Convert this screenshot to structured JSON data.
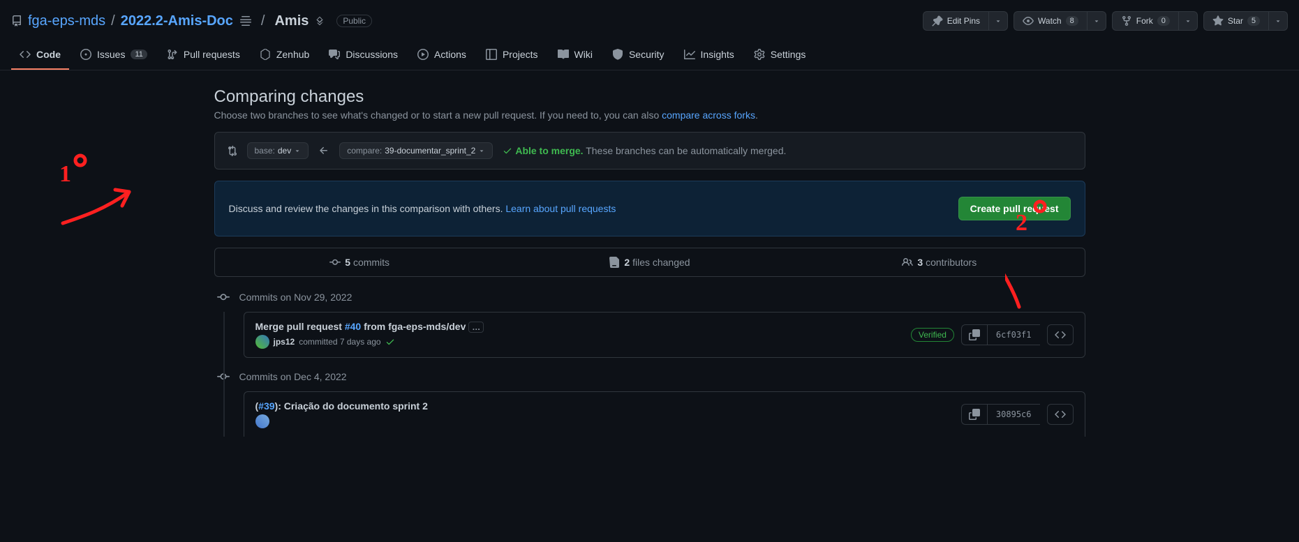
{
  "repo": {
    "owner": "fga-eps-mds",
    "name": "2022.2-Amis-Doc",
    "context": "Amis",
    "visibility": "Public"
  },
  "header_buttons": {
    "edit_pins": "Edit Pins",
    "watch": "Watch",
    "watch_count": "8",
    "fork": "Fork",
    "fork_count": "0",
    "star": "Star",
    "star_count": "5"
  },
  "tabs": {
    "code": "Code",
    "issues": "Issues",
    "issues_count": "11",
    "pulls": "Pull requests",
    "zenhub": "Zenhub",
    "discussions": "Discussions",
    "actions": "Actions",
    "projects": "Projects",
    "wiki": "Wiki",
    "security": "Security",
    "insights": "Insights",
    "settings": "Settings"
  },
  "page": {
    "title": "Comparing changes",
    "subtitle_a": "Choose two branches to see what's changed or to start a new pull request. If you need to, you can also ",
    "subtitle_link": "compare across forks",
    "subtitle_b": "."
  },
  "range": {
    "base_label": "base:",
    "base_value": "dev",
    "compare_label": "compare:",
    "compare_value": "39-documentar_sprint_2",
    "able": "Able to merge.",
    "auto": "These branches can be automatically merged."
  },
  "discuss": {
    "text": "Discuss and review the changes in this comparison with others. ",
    "link": "Learn about pull requests",
    "button": "Create pull request"
  },
  "stats": {
    "commits_n": "5",
    "commits_l": "commits",
    "files_n": "2",
    "files_l": "files changed",
    "contrib_n": "3",
    "contrib_l": "contributors"
  },
  "timeline": [
    {
      "heading": "Commits on Nov 29, 2022",
      "commit": {
        "title_pre": "Merge pull request ",
        "title_link": "#40",
        "title_post": " from fga-eps-mds/dev",
        "user": "jps12",
        "committed": "committed 7 days ago",
        "verified": "Verified",
        "sha": "6cf03f1",
        "has_more": true
      }
    },
    {
      "heading": "Commits on Dec 4, 2022",
      "commit": {
        "title_pre": "(",
        "title_link": "#39",
        "title_post": "): Criação do documento sprint 2",
        "user": "",
        "committed": "",
        "verified": "",
        "sha": "30895c6",
        "has_more": false
      }
    }
  ]
}
